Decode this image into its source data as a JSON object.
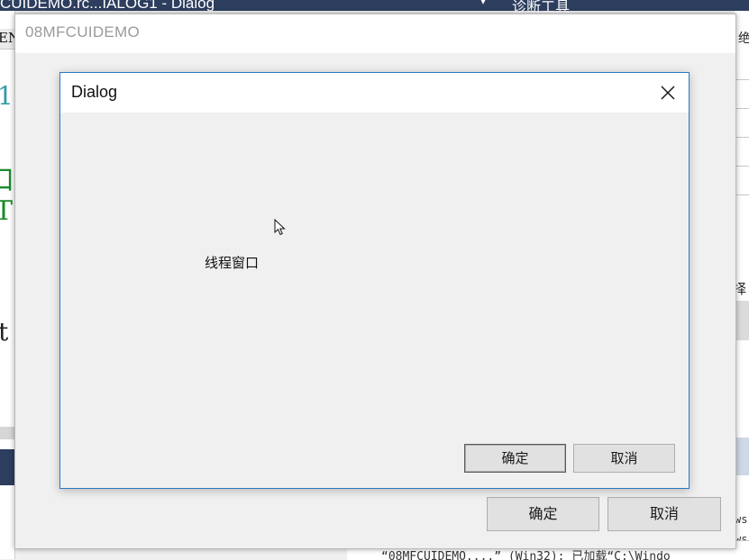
{
  "ide": {
    "tab_text": "CUIDEMO.rc...IALOG1 - Dialog",
    "dropdown_glyph": "▾",
    "right_panel_title": "诊断工具",
    "left_fragments": [
      "EN",
      "1",
      "口",
      "T",
      "t"
    ],
    "right_fragments": [
      "绝",
      "择",
      "ws",
      "ws"
    ],
    "output_text": "“08MFCUIDEMO....” (Win32): 已加载“C:\\Windo"
  },
  "app_window": {
    "title": "08MFCUIDEMO",
    "ok_label": "确定",
    "cancel_label": "取消"
  },
  "dialog": {
    "title": "Dialog",
    "close_icon": "close-icon",
    "static_text": "线程窗口",
    "ok_label": "确定",
    "cancel_label": "取消"
  },
  "colors": {
    "ide_dark": "#2d3e5e",
    "dialog_border": "#2b78c2",
    "dialog_face": "#f0f0f0"
  }
}
